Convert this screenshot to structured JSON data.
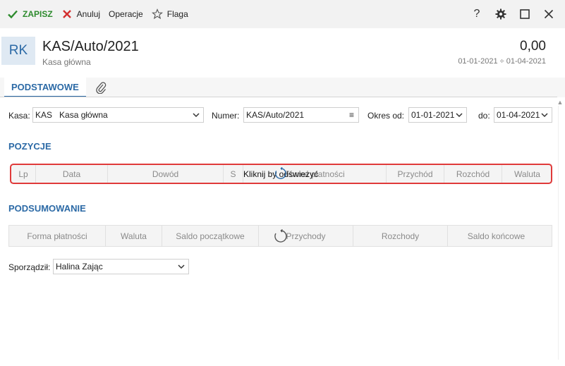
{
  "toolbar": {
    "save_label": "ZAPISZ",
    "cancel_label": "Anuluj",
    "operations_label": "Operacje",
    "flag_label": "Flaga",
    "help_label": "?"
  },
  "header": {
    "badge": "RK",
    "title": "KAS/Auto/2021",
    "subtitle": "Kasa główna",
    "amount": "0,00",
    "period": "01-01-2021 ÷ 01-04-2021"
  },
  "tabs": {
    "main_label": "PODSTAWOWE"
  },
  "form": {
    "kasa_label": "Kasa:",
    "kasa_code": "KAS",
    "kasa_name": "Kasa główna",
    "numer_label": "Numer:",
    "numer_value": "KAS/Auto/2021",
    "okres_label": "Okres od:",
    "okres_from": "01-01-2021",
    "do_label": "do:",
    "okres_to": "01-04-2021"
  },
  "positions": {
    "title": "POZYCJE",
    "columns": [
      "Lp",
      "Data",
      "Dowód",
      "S",
      "Forma płatności",
      "Przychód",
      "Rozchód",
      "Waluta"
    ],
    "refresh_text": "Kliknij by odświeżyć"
  },
  "summary": {
    "title": "PODSUMOWANIE",
    "columns": [
      "Forma płatności",
      "Waluta",
      "Saldo początkowe",
      "Przychody",
      "Rozchody",
      "Saldo końcowe"
    ]
  },
  "signer": {
    "label": "Sporządził:",
    "value": "Halina Zając"
  },
  "colors": {
    "accent": "#2c6aa6",
    "save_green": "#2e8b2e",
    "cancel_red": "#d32f2f",
    "highlight_red": "#e03a3a"
  }
}
